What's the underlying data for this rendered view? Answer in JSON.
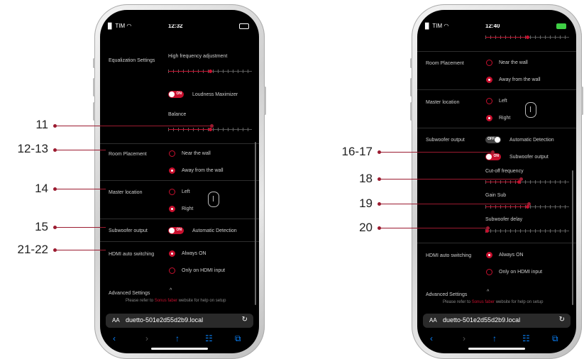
{
  "left_phone": {
    "status": {
      "carrier": "▐▌ TIM ◠",
      "time": "12:32"
    },
    "equalization": {
      "label": "Equalization Settings",
      "high_freq_label": "High frequency adjustment",
      "high_freq_value": 0.5
    },
    "loudness": {
      "label": "Loudness Maximizer",
      "toggle_text": "ON"
    },
    "balance": {
      "label": "Balance",
      "value": 0.5
    },
    "room_placement": {
      "label": "Room Placement",
      "options": [
        "Near the wall",
        "Away from the wall"
      ],
      "selected": 1
    },
    "master_location": {
      "label": "Master location",
      "options": [
        "Left",
        "Right"
      ],
      "selected": 1
    },
    "subwoofer": {
      "label": "Subwoofer output",
      "toggle_text": "ON",
      "auto_label": "Automatic Detection"
    },
    "hdmi": {
      "label": "HDMI auto switching",
      "options": [
        "Always ON",
        "Only on HDMI input"
      ],
      "selected": 0
    },
    "advanced": {
      "label": "Advanced Settings",
      "chevron": "^"
    },
    "help": {
      "pre": "Please refer to ",
      "brand": "Sonus faber",
      "post": " website for help on setup"
    },
    "urlbar": {
      "aa": "AA",
      "url": "duetto-501e2d55d2b9.local",
      "reload": "↻"
    },
    "toolbar": {
      "back": "‹",
      "forward": "›",
      "share": "↑",
      "bookmarks": "☷",
      "tabs": "⧉"
    }
  },
  "right_phone": {
    "status": {
      "carrier": "▐▌ TIM ◠",
      "time": "12:40"
    },
    "room_placement": {
      "label": "Room Placement",
      "options": [
        "Near the wall",
        "Away from the wall"
      ],
      "selected": 1
    },
    "master_location": {
      "label": "Master location",
      "options": [
        "Left",
        "Right"
      ],
      "selected": 1
    },
    "subwoofer": {
      "label": "Subwoofer output",
      "auto_toggle_text": "OFF",
      "auto_label": "Automatic Detection",
      "output_toggle_text": "ON",
      "output_label": "Subwoofer output"
    },
    "cutoff": {
      "label": "Cut-off frequency",
      "value": 0.4
    },
    "gain": {
      "label": "Gain Sub",
      "value": 0.5
    },
    "delay": {
      "label": "Subwoofer delay",
      "value": 0.0
    },
    "hdmi": {
      "label": "HDMI auto switching",
      "options": [
        "Always ON",
        "Only on HDMI input"
      ],
      "selected": 0
    },
    "advanced": {
      "label": "Advanced Settings",
      "chevron": "^"
    },
    "help": {
      "pre": "Please refer to ",
      "brand": "Sonus faber",
      "post": " website for help on setup"
    },
    "urlbar": {
      "aa": "AA",
      "url": "duetto-501e2d55d2b9.local",
      "reload": "↻"
    },
    "toolbar": {
      "back": "‹",
      "forward": "›",
      "share": "↑",
      "bookmarks": "☷",
      "tabs": "⧉"
    }
  },
  "callouts": {
    "left": [
      "11",
      "12-13",
      "14",
      "15",
      "21-22"
    ],
    "right": [
      "16-17",
      "18",
      "19",
      "20"
    ]
  },
  "colors": {
    "accent": "#c8102e",
    "callout": "#9b1b30",
    "background": "#000000",
    "ios_blue": "#0a84ff"
  }
}
